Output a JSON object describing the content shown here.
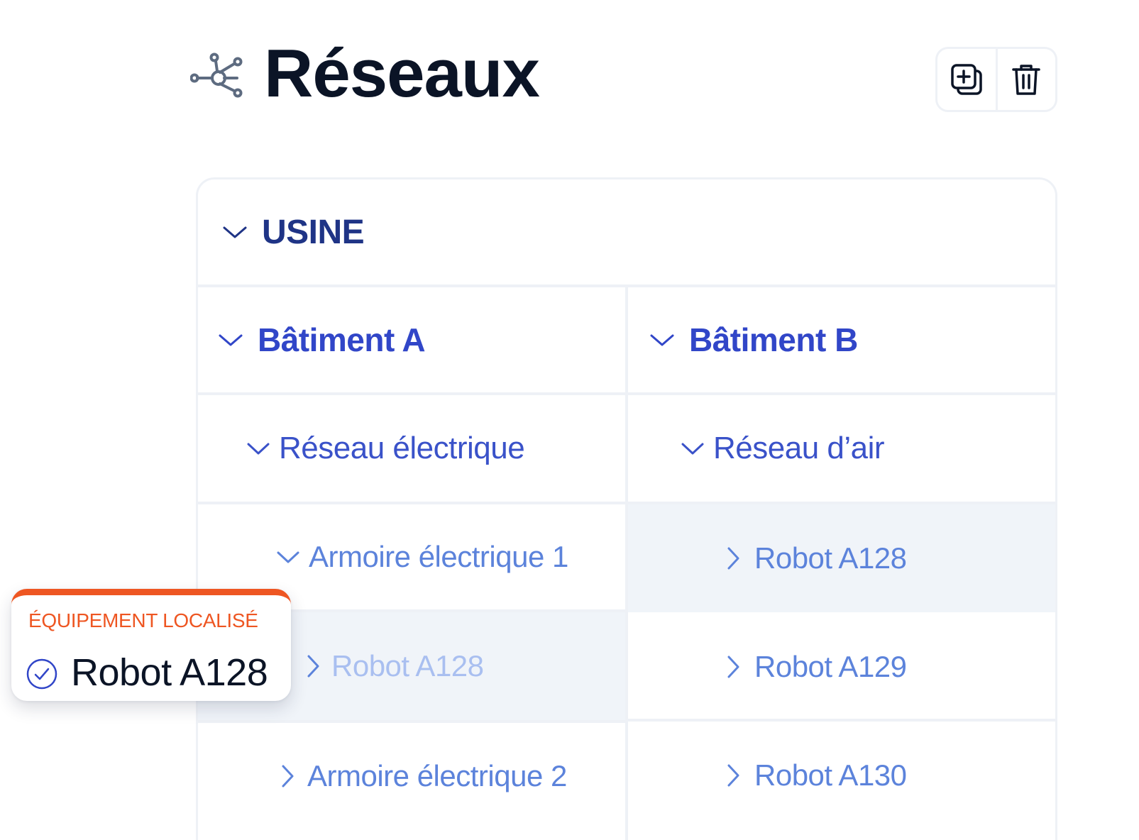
{
  "header": {
    "title": "Réseaux",
    "icon": "network-icon",
    "toolbar": {
      "add_icon": "add-icon",
      "delete_icon": "trash-icon"
    }
  },
  "tree": {
    "root": {
      "label": "USINE",
      "expanded": true
    },
    "buildings": [
      {
        "label": "Bâtiment A",
        "expanded": true,
        "network": {
          "label": "Réseau électrique",
          "expanded": true
        },
        "items": [
          {
            "label": "Armoire électrique 1",
            "expanded": true
          },
          {
            "label": "Robot A128",
            "expanded": false,
            "selected": true
          },
          {
            "label": "Armoire électrique 2",
            "expanded": false
          }
        ]
      },
      {
        "label": "Bâtiment B",
        "expanded": true,
        "network": {
          "label": "Réseau d’air",
          "expanded": true
        },
        "items": [
          {
            "label": "Robot A128",
            "expanded": false,
            "selected": true
          },
          {
            "label": "Robot A129",
            "expanded": false
          },
          {
            "label": "Robot A130",
            "expanded": false
          }
        ]
      }
    ]
  },
  "callout": {
    "title": "ÉQUIPEMENT LOCALISÉ",
    "value": "Robot A128",
    "icon": "check-circle-icon",
    "accent_color": "#ee5622"
  },
  "colors": {
    "title": "#0b1426",
    "root": "#1f3486",
    "building": "#3146c8",
    "item": "#5c83db",
    "highlight_bg": "#f0f4f9"
  }
}
